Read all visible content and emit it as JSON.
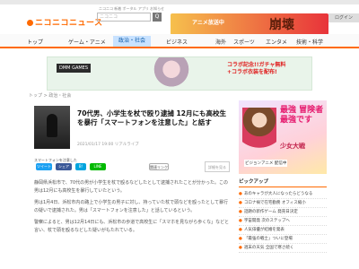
{
  "header": {
    "logo": "ニコニコニュース",
    "links": "ニコニコ  新着  ポータル  アプリ  お知らせ",
    "search_placeholder": "ニコニコ",
    "search_btn": "Q",
    "login": "ログイン",
    "ad_text": "アニメ放送中",
    "ad_big": "崩壊"
  },
  "nav": [
    "トップ",
    "ゲーム・アニメ",
    "政治・社会",
    "ビジネス",
    "海外",
    "スポーツ",
    "エンタメ",
    "技術・科学"
  ],
  "banner": {
    "ctx": "DMM GAMES",
    "promo_line1": "コラボ記念!!ガチャ無料",
    "promo_line2": "+コラボ衣装を配布!"
  },
  "breadcrumb": "トップ > 政治・社会",
  "article": {
    "title": "70代男、小学生を杖で殴り逮捕 12月にも高校生を暴行「スマートフォンを注意した」と話す",
    "date": "2021/01/17 19:00   リアルライブ",
    "share_label": "スマートフォンを注意した",
    "btn_tw": "ツイート",
    "btn_fb": "シェア",
    "btn_hb": "B!",
    "btn_line": "LINE",
    "btn_link": "関連リンク",
    "btn_more": "詳細を見る",
    "paragraphs": [
      "静岡県浜松市で、70代の男が小学生を杖で殴るなどしたとして逮捕されたことが分かった。この男は12月にも高校生を暴行していたという。",
      "男は1月4日、浜松市内の路上で小学生の男子に対し、持っていた杖で頭などを殴ったとして暴行の疑いで逮捕された。男は「スマートフォンを注意した」と話しているという。",
      "警察によると、男は12月14日にも、浜松市の歩道で高校生に「スマホを見ながら歩くな」などと言い、杖で頭を殴るなどした疑いがもたれている。"
    ]
  },
  "side_ad": {
    "t1": "最強 冒険者 最強です",
    "t2": "少女大戦",
    "t3": "ビジョンアニメ 配信中"
  },
  "pickup": {
    "header": "ピックアップ",
    "items": [
      "あのキャラが大人になったらどうなる",
      "コロナ禍で在宅勤務 オフィス縮小",
      "話題の新作ゲーム 発売日決定",
      "宇宙開発 次のステップへ",
      "人気俳優が結婚を発表",
      "「最強の戦士」ついに登場",
      "週末の天気 全国で寒さ続く"
    ]
  }
}
